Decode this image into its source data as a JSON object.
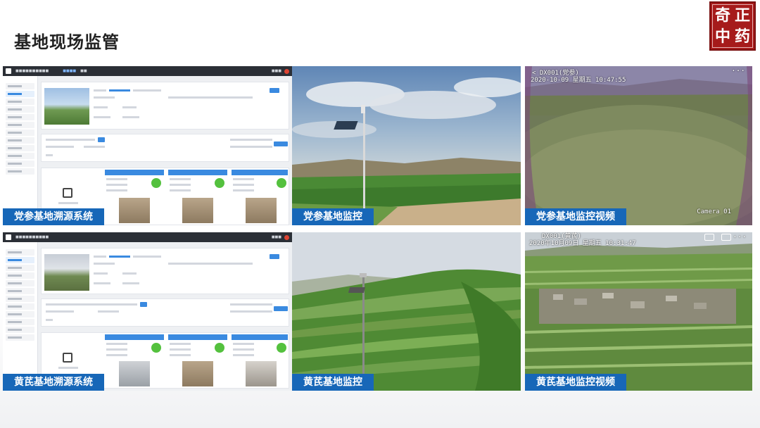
{
  "slide": {
    "title": "基地现场监管",
    "logo_chars": [
      "奇",
      "正",
      "中",
      "药"
    ]
  },
  "panels": [
    {
      "caption": "党参基地溯源系统",
      "kind": "software"
    },
    {
      "caption": "党参基地监控",
      "kind": "photo"
    },
    {
      "caption": "党参基地监控视频",
      "kind": "video",
      "overlay_top": "<  DX001(党参)",
      "overlay_time": "2020-10-09 星期五 10:47:55",
      "overlay_bottom": "Camera 01",
      "overlay_menu": "···"
    },
    {
      "caption": "黄芪基地溯源系统",
      "kind": "software"
    },
    {
      "caption": "黄芪基地监控",
      "kind": "photo"
    },
    {
      "caption": "黄芪基地监控视频",
      "kind": "video",
      "overlay_top": "DX001(黄芪)",
      "overlay_time": "2020年10月09日 星期五 10:31:47",
      "overlay_bottom": "",
      "overlay_menu": "···"
    }
  ]
}
